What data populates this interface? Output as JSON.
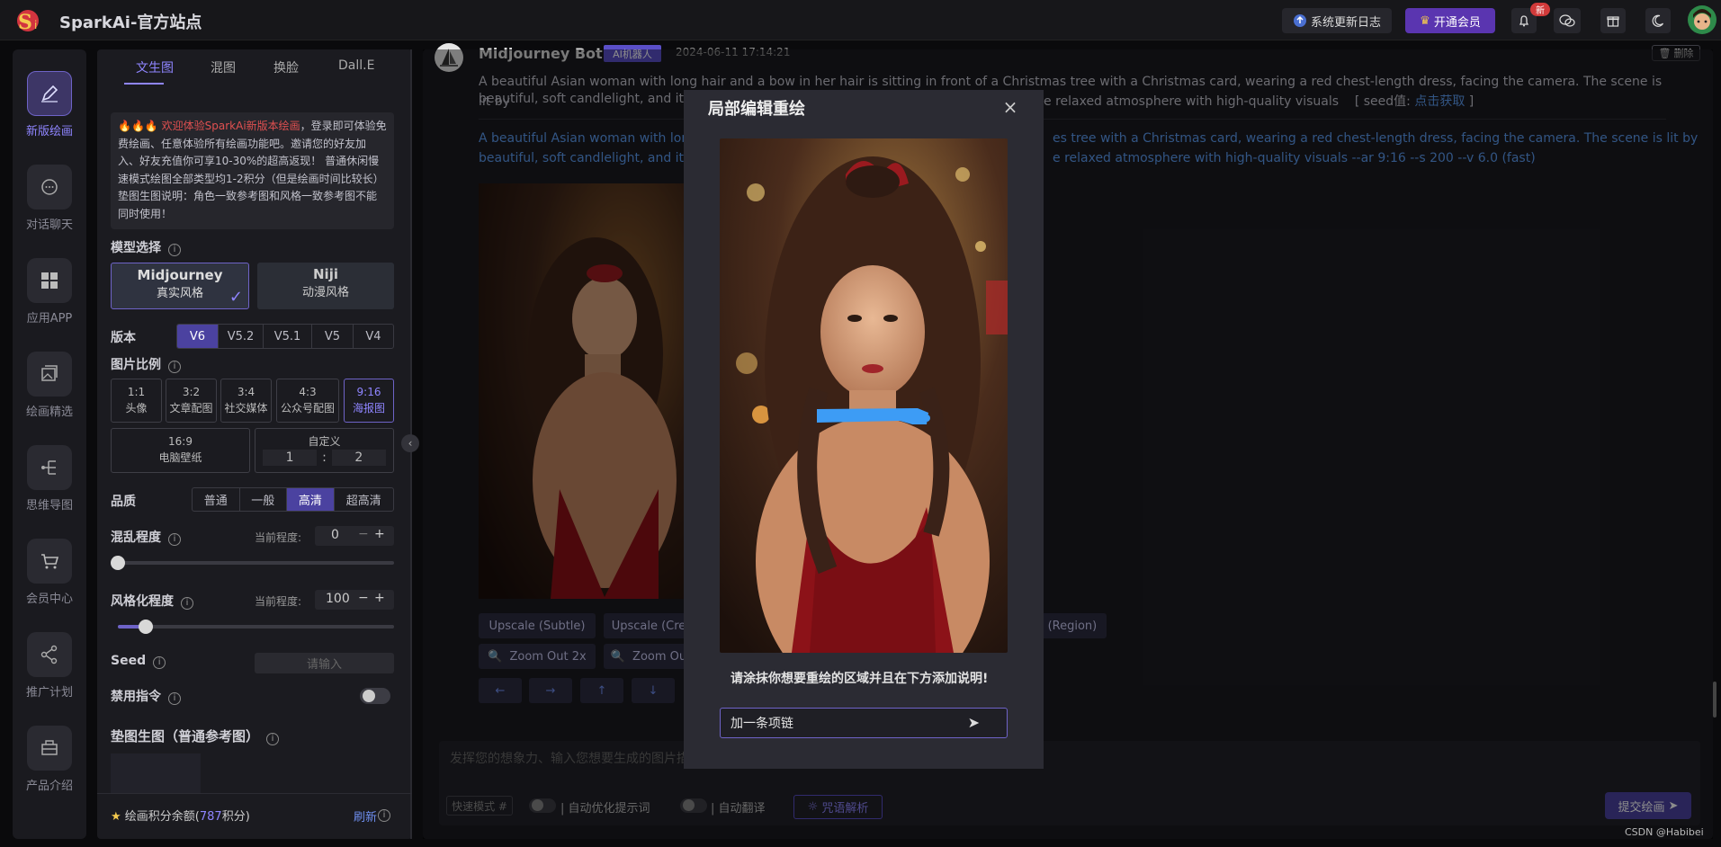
{
  "topbar": {
    "brand": "SparkAi-官方站点",
    "update_log": "系统更新日志",
    "vip": "开通会员",
    "bell_badge": "新"
  },
  "rail": [
    {
      "label": "新版绘画",
      "icon": "pen-icon"
    },
    {
      "label": "对话聊天",
      "icon": "chat-icon"
    },
    {
      "label": "应用APP",
      "icon": "apps-icon"
    },
    {
      "label": "绘画精选",
      "icon": "gallery-icon"
    },
    {
      "label": "思维导图",
      "icon": "mindmap-icon"
    },
    {
      "label": "会员中心",
      "icon": "cart-icon"
    },
    {
      "label": "推广计划",
      "icon": "share-icon"
    },
    {
      "label": "产品介绍",
      "icon": "product-icon"
    }
  ],
  "panel": {
    "tabs": [
      "文生图",
      "混图",
      "换脸",
      "Dall.E"
    ],
    "notice_highlight": "欢迎体验SparkAi新版本绘画",
    "notice_body": "，登录即可体验免费绘画、任意体验所有绘画功能吧。邀请您的好友加入、好友充值你可享10-30%的超高返现！ 普通休闲慢速模式绘图全部类型均1-2积分（但是绘画时间比较长）垫图生图说明：角色一致参考图和风格一致参考图不能同时使用！",
    "model_label": "模型选择",
    "models": [
      {
        "name": "Midjourney",
        "sub": "真实风格"
      },
      {
        "name": "Niji",
        "sub": "动漫风格"
      }
    ],
    "version_label": "版本",
    "versions": [
      "V6",
      "V5.2",
      "V5.1",
      "V5",
      "V4"
    ],
    "ratio_label": "图片比例",
    "ratios": [
      {
        "r": "1:1",
        "d": "头像"
      },
      {
        "r": "3:2",
        "d": "文章配图"
      },
      {
        "r": "3:4",
        "d": "社交媒体"
      },
      {
        "r": "4:3",
        "d": "公众号配图"
      },
      {
        "r": "9:16",
        "d": "海报图"
      }
    ],
    "ratio_wide": {
      "r": "16:9",
      "d": "电脑壁纸"
    },
    "custom": {
      "label": "自定义",
      "a": "1",
      "sep": ":",
      "b": "2"
    },
    "quality_label": "品质",
    "qualities": [
      "普通",
      "一般",
      "高清",
      "超高清"
    ],
    "chaos_label": "混乱程度",
    "chaos_current": "当前程度:",
    "chaos_value": "0",
    "chaos_level": 0,
    "stylize_label": "风格化程度",
    "stylize_current": "当前程度:",
    "stylize_value": "100",
    "stylize_level": 0.1,
    "seed_label": "Seed",
    "seed_placeholder": "请输入",
    "ban_label": "禁用指令",
    "ref_label": "垫图生图（普通参考图）",
    "points_prefix": "绘画积分余额(",
    "points_value": "787",
    "points_suffix": "积分)",
    "refresh": "刷新"
  },
  "message": {
    "bot": "Midjourney Bot",
    "badge": "AI机器人",
    "time": "2024-06-11 17:14:21",
    "delete": "删除",
    "prompt_line1": "A beautiful Asian woman with long hair and a bow in her hair is sitting in front of a Christmas tree with a Christmas card, wearing a red chest-length dress, facing the camera. The scene is lit by",
    "prompt_line2a": "beautiful, soft candlelight, and it's",
    "prompt_line2b": "e relaxed atmosphere with high-quality visuals",
    "seed_prefix": "[ seed值:",
    "seed_link": "点击获取",
    "seed_suffix": "]",
    "full_line1a": "A beautiful Asian woman with long",
    "full_line1b": "es tree with a Christmas card, wearing a red chest-length dress, facing the camera. The scene is lit by",
    "full_line2a": "beautiful, soft candlelight, and it's",
    "full_line2b": "e relaxed atmosphere with high-quality visuals --ar 9:16 --s 200 --v 6.0  (fast)",
    "buttons": [
      "Upscale (Subtle)",
      "Upscale (Cre",
      "y (Region)",
      "Zoom Out 2x",
      "Zoom Ou"
    ],
    "arrows": [
      "←",
      "→",
      "↑",
      "↓"
    ]
  },
  "input": {
    "placeholder": "发挥您的想象力、输入您想要生成的图片描",
    "mode": "快速模式 #",
    "auto_opt": "自动优化提示词",
    "auto_trans": "自动翻译",
    "parse": "咒语解析",
    "submit": "提交绘画"
  },
  "modal": {
    "title": "局部编辑重绘",
    "hint": "请涂抹你想要重绘的区域并且在下方添加说明!",
    "value": "加一条项链"
  },
  "watermark": "CSDN @Habibei",
  "colors": {
    "accent": "#6e63c7",
    "link": "#5c9bf0",
    "mask": "#3d9cf5"
  }
}
